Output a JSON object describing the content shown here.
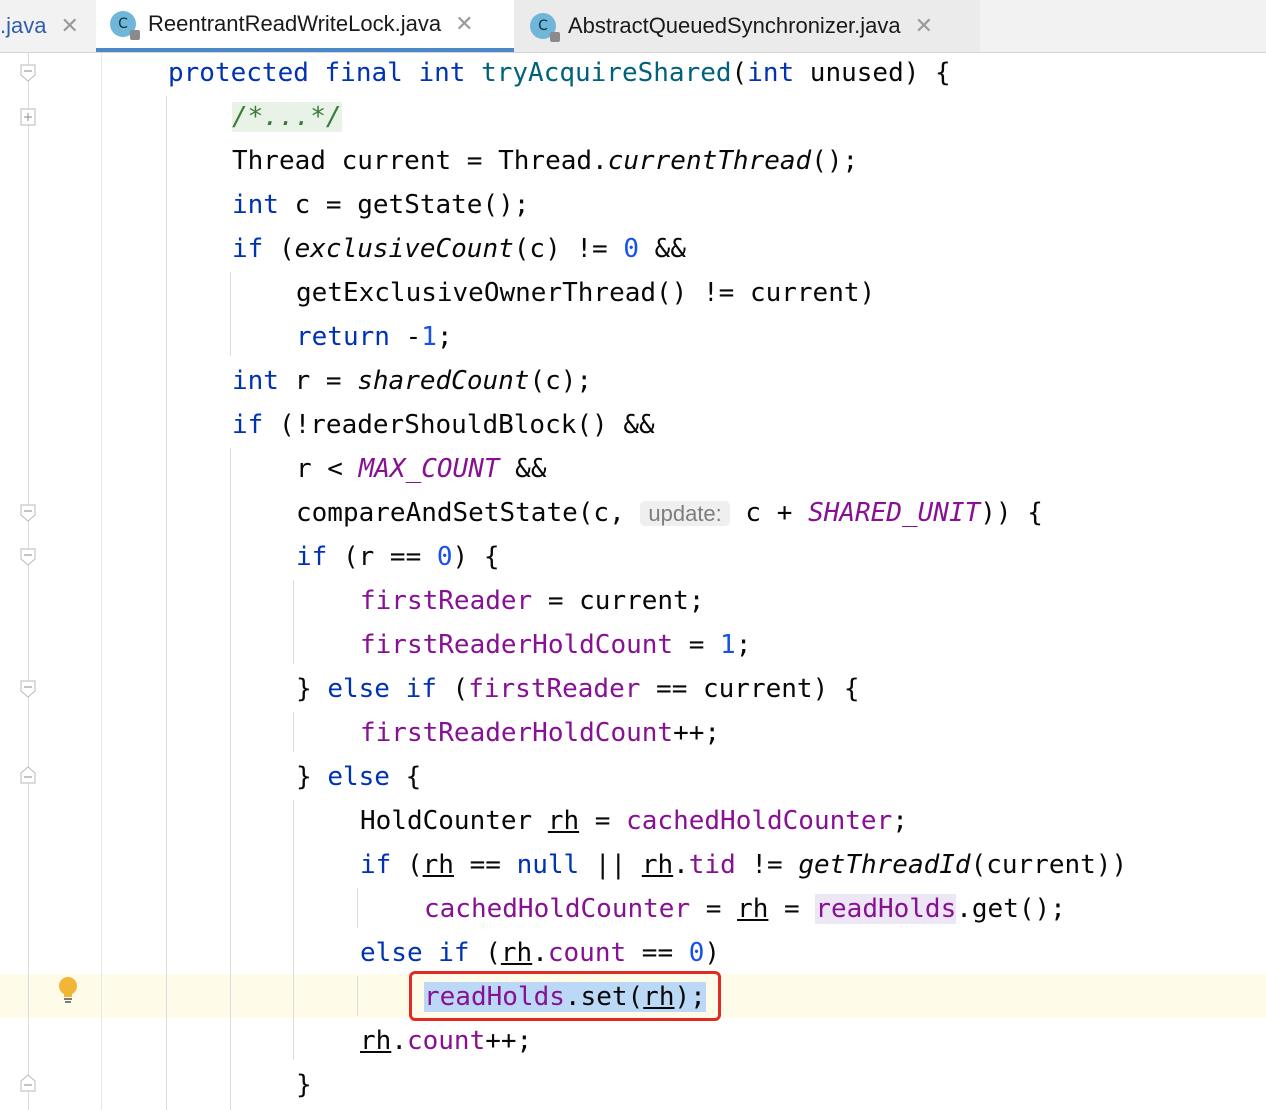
{
  "tabs": [
    {
      "label": ".java"
    },
    {
      "label": "ReentrantReadWriteLock.java",
      "icon": "C"
    },
    {
      "label": "AbstractQueuedSynchronizer.java",
      "icon": "C"
    }
  ],
  "close_glyph": "✕",
  "code": {
    "l1_mods": "protected final int",
    "l1_name": "tryAcquireShared",
    "l1_open": "(",
    "l1_type": "int",
    "l1_rest": " unused) {",
    "l2_comment": "/*...*/",
    "l3a": "Thread current = Thread.",
    "l3b": "currentThread",
    "l3c": "();",
    "l4_kw": "int",
    "l4_rest": " c = getState();",
    "l5_kw": "if",
    "l5a": " (",
    "l5b": "exclusiveCount",
    "l5c": "(c) != ",
    "l5_num": "0",
    "l5d": " &&",
    "l6": "getExclusiveOwnerThread() != current)",
    "l7_kw": "return",
    "l7a": " -",
    "l7_num": "1",
    "l7b": ";",
    "l8_kw": "int",
    "l8a": " r = ",
    "l8b": "sharedCount",
    "l8c": "(c);",
    "l9_kw": "if",
    "l9_rest": " (!readerShouldBlock() &&",
    "l10a": "r < ",
    "l10b": "MAX_COUNT",
    "l10c": " &&",
    "l11a": "compareAndSetState(c, ",
    "l11_hint": "update:",
    "l11b": " c + ",
    "l11c": "SHARED_UNIT",
    "l11d": ")) {",
    "l12_kw": "if",
    "l12a": " (r == ",
    "l12_num": "0",
    "l12b": ") {",
    "l13a": "firstReader",
    "l13b": " = current;",
    "l14a": "firstReaderHoldCount",
    "l14b": " = ",
    "l14_num": "1",
    "l14c": ";",
    "l15a": "} ",
    "l15_kw": "else if",
    "l15b": " (",
    "l15c": "firstReader",
    "l15d": " == current) {",
    "l16a": "firstReaderHoldCount",
    "l16b": "++;",
    "l17a": "} ",
    "l17_kw": "else",
    "l17b": " {",
    "l18a": "HoldCounter ",
    "l18_rh": "rh",
    "l18b": " = ",
    "l18c": "cachedHoldCounter",
    "l18d": ";",
    "l19_kw": "if",
    "l19a": " (",
    "l19_rh": "rh",
    "l19b": " == ",
    "l19_null": "null",
    "l19c": " || ",
    "l19_rh2": "rh",
    "l19d": ".",
    "l19_tid": "tid",
    "l19e": " != ",
    "l19f": "getThreadId",
    "l19g": "(current))",
    "l20a": "cachedHoldCounter",
    "l20b": " = ",
    "l20_rh": "rh",
    "l20c": " = ",
    "l20d": "readHolds",
    "l20e": ".get();",
    "l21_kw": "else if",
    "l21a": " (",
    "l21_rh": "rh",
    "l21b": ".",
    "l21c": "count",
    "l21d": " == ",
    "l21_num": "0",
    "l21e": ")",
    "l22a": "readHolds",
    "l22b": ".set(",
    "l22_rh": "rh",
    "l22c": ");",
    "l23_rh": "rh",
    "l23a": ".",
    "l23b": "count",
    "l23c": "++;",
    "l24": "}"
  },
  "colors": {
    "keyword": "#0033b3",
    "number": "#1750eb",
    "field": "#871094",
    "highlight_box": "#e02a23",
    "selection": "#bcd8f7"
  }
}
